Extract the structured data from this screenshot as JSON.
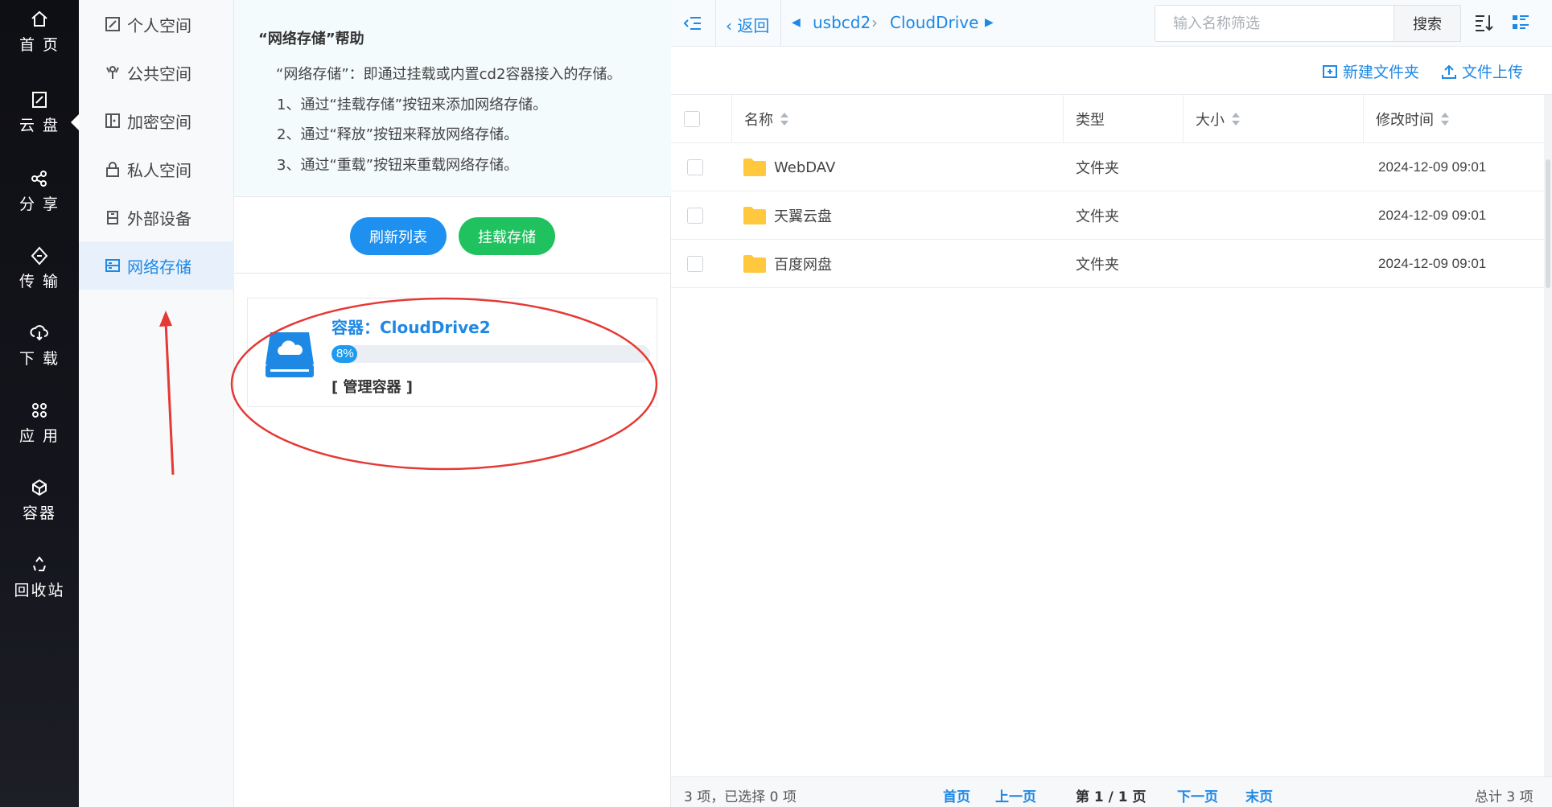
{
  "leftnav": {
    "items": [
      {
        "label": "首 页",
        "icon": "home-icon"
      },
      {
        "label": "云 盘",
        "icon": "cloud-disk-icon"
      },
      {
        "label": "分 享",
        "icon": "share-icon"
      },
      {
        "label": "传 输",
        "icon": "transfer-icon"
      },
      {
        "label": "下 载",
        "icon": "download-icon"
      },
      {
        "label": "应 用",
        "icon": "apps-icon"
      },
      {
        "label": "容器",
        "icon": "container-icon"
      },
      {
        "label": "回收站",
        "icon": "recycle-icon"
      }
    ],
    "active_index": 1
  },
  "subnav": {
    "items": [
      {
        "label": "个人空间",
        "icon": "personal-space-icon"
      },
      {
        "label": "公共空间",
        "icon": "public-space-icon"
      },
      {
        "label": "加密空间",
        "icon": "encrypted-space-icon"
      },
      {
        "label": "私人空间",
        "icon": "private-space-icon"
      },
      {
        "label": "外部设备",
        "icon": "external-device-icon"
      },
      {
        "label": "网络存储",
        "icon": "network-storage-icon"
      }
    ],
    "active_index": 5
  },
  "help": {
    "title": "“网络存储”帮助",
    "lines": [
      "“网络存储”：即通过挂载或内置cd2容器接入的存储。",
      "1、通过“挂载存储”按钮来添加网络存储。",
      "2、通过“释放”按钮来释放网络存储。",
      "3、通过“重载”按钮来重载网络存储。"
    ]
  },
  "buttons": {
    "refresh": "刷新列表",
    "mount": "挂载存储"
  },
  "container_card": {
    "title": "容器：CloudDrive2",
    "usage_percent": 8,
    "usage_label": "8%",
    "manage_label": "[ 管理容器 ]"
  },
  "toolbar": {
    "back_label": "返回",
    "breadcrumb": [
      "usbcd2",
      "CloudDrive"
    ],
    "search_placeholder": "输入名称筛选",
    "search_button": "搜索"
  },
  "actions": {
    "new_folder": "新建文件夹",
    "upload": "文件上传"
  },
  "table": {
    "columns": [
      "名称",
      "类型",
      "大小",
      "修改时间"
    ],
    "rows": [
      {
        "name": "WebDAV",
        "type": "文件夹",
        "size": "",
        "modified": "2024-12-09 09:01"
      },
      {
        "name": "天翼云盘",
        "type": "文件夹",
        "size": "",
        "modified": "2024-12-09 09:01"
      },
      {
        "name": "百度网盘",
        "type": "文件夹",
        "size": "",
        "modified": "2024-12-09 09:01"
      }
    ]
  },
  "footer": {
    "summary": "3 项，已选择 0 项",
    "first": "首页",
    "prev": "上一页",
    "page": "第 1 / 1 页",
    "next": "下一页",
    "last": "末页",
    "total": "总计 3 项"
  },
  "colors": {
    "accent": "#1e88e5",
    "green": "#1fc25e",
    "annotation": "#e53935",
    "folder": "#ffc83d"
  }
}
